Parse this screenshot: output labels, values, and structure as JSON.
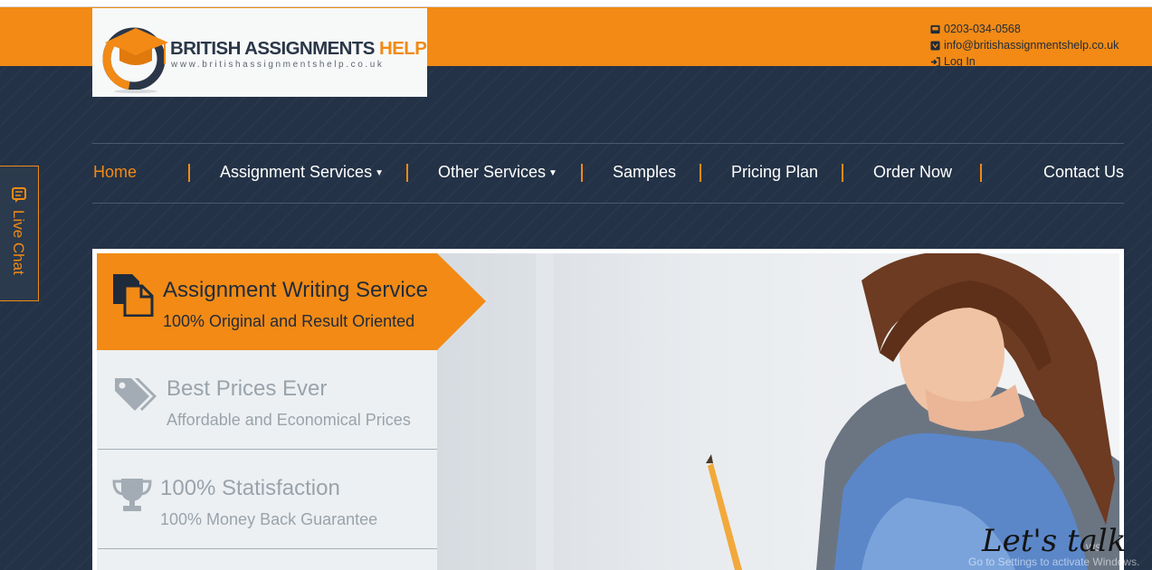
{
  "header": {
    "phone": "0203-034-0568",
    "email": "info@britishassignmentshelp.co.uk",
    "login": "Log In"
  },
  "logo": {
    "title_main": "BRITISH ASSIGNMENTS",
    "title_accent": "HELP",
    "url": "www.britishassignmentshelp.co.uk"
  },
  "nav": {
    "items": [
      {
        "label": "Home",
        "active": true
      },
      {
        "label": "Assignment Services",
        "dropdown": true
      },
      {
        "label": "Other Services",
        "dropdown": true
      },
      {
        "label": "Samples"
      },
      {
        "label": "Pricing Plan"
      },
      {
        "label": "Order Now"
      },
      {
        "label": "Contact Us"
      }
    ]
  },
  "live_chat": {
    "label": "Live Chat"
  },
  "features": [
    {
      "title": "Assignment Writing Service",
      "subtitle": "100% Original and Result Oriented",
      "icon": "documents-icon",
      "active": true
    },
    {
      "title": "Best Prices Ever",
      "subtitle": "Affordable and Economical Prices",
      "icon": "tags-icon"
    },
    {
      "title": "100% Statisfaction",
      "subtitle": "100% Money Back Guarantee",
      "icon": "trophy-icon"
    }
  ],
  "chat_widget": {
    "label": "Let's talk"
  },
  "os_watermark": {
    "line1": "ws",
    "line2": "Go to Settings to activate Windows."
  },
  "colors": {
    "accent": "#f28a15",
    "navy": "#233246",
    "panel": "#ecf0f2"
  }
}
